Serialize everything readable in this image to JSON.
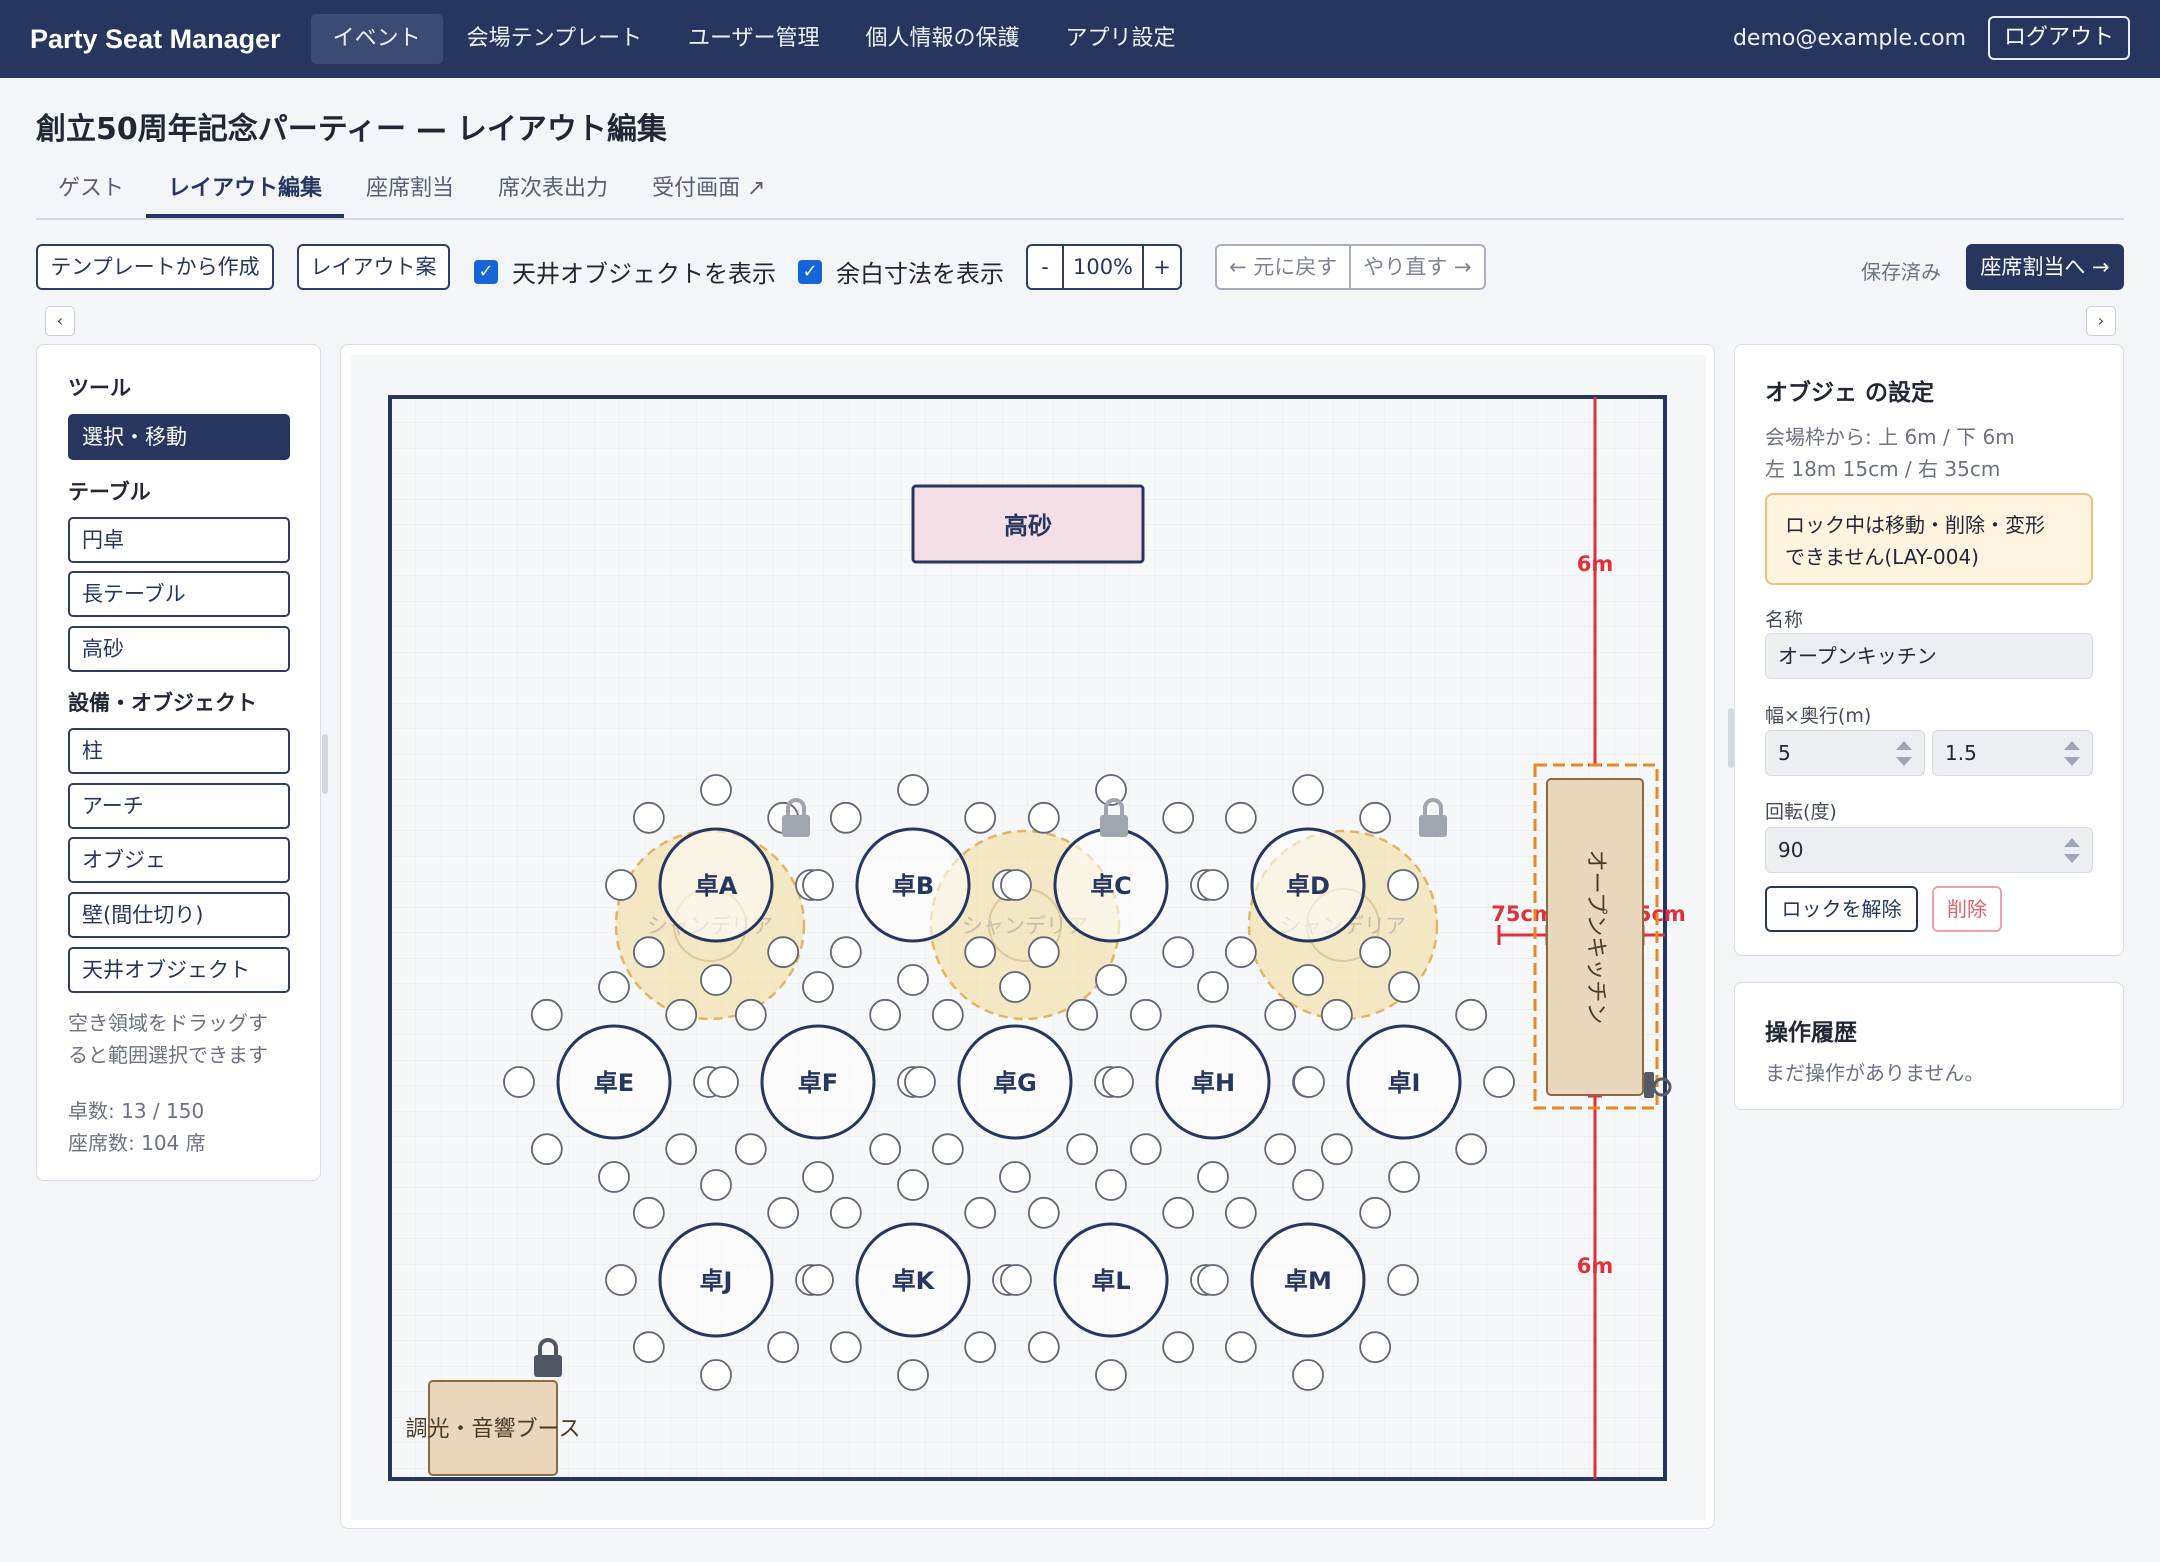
{
  "app": {
    "brand": "Party Seat Manager",
    "nav": [
      "イベント",
      "会場テンプレート",
      "ユーザー管理",
      "個人情報の保護",
      "アプリ設定"
    ],
    "user_email": "demo@example.com",
    "logout_label": "ログアウト"
  },
  "page": {
    "title": "創立50周年記念パーティー — レイアウト編集",
    "tabs": [
      "ゲスト",
      "レイアウト編集",
      "座席割当",
      "席次表出力",
      "受付画面 ↗"
    ],
    "active_tab": "レイアウト編集"
  },
  "toolbar": {
    "template_button": "テンプレートから作成",
    "layout_button": "レイアウト案",
    "show_ceiling_label": "天井オブジェクトを表示",
    "show_margin_label": "余白寸法を表示",
    "zoom_minus": "-",
    "zoom_value": "100%",
    "zoom_plus": "+",
    "undo_label": "← 元に戻す",
    "redo_label": "やり直す →",
    "save_status": "保存済み",
    "next_button": "座席割当へ →",
    "collapse_left": "‹",
    "collapse_right": "›"
  },
  "left_panel": {
    "tools_heading": "ツール",
    "select_tool": "選択・移動",
    "tables_heading": "テーブル",
    "table_tools": [
      "円卓",
      "長テーブル",
      "高砂"
    ],
    "objects_heading": "設備・オブジェクト",
    "object_tools": [
      "柱",
      "アーチ",
      "オブジェ",
      "壁(間仕切り)",
      "天井オブジェクト"
    ],
    "hint_line1": "空き領域をドラッグす",
    "hint_line2": "ると範囲選択できます",
    "table_count": "卓数: 13 / 150",
    "seat_count": "座席数: 104 席"
  },
  "canvas": {
    "head_table": "高砂",
    "tables": [
      "卓A",
      "卓B",
      "卓C",
      "卓D",
      "卓E",
      "卓F",
      "卓G",
      "卓H",
      "卓I",
      "卓J",
      "卓K",
      "卓L",
      "卓M"
    ],
    "chandelier_label": "シャンデリア",
    "kitchen_label": "オープンキッチン",
    "booth_label": "調光・音響ブース",
    "dim_top": "6m",
    "dim_bottom": "6m",
    "dim_left": "75cm",
    "dim_right": "35cm"
  },
  "right_panel": {
    "title": "オブジェ の設定",
    "distance_line1": "会場枠から: 上 6m / 下 6m",
    "distance_line2": "左 18m 15cm / 右 35cm",
    "lock_warning_line1": "ロック中は移動・削除・変形",
    "lock_warning_line2": "できません(LAY-004)",
    "name_label": "名称",
    "name_value": "オープンキッチン",
    "size_label": "幅×奥行(m)",
    "width_value": "5",
    "depth_value": "1.5",
    "rotation_label": "回転(度)",
    "rotation_value": "90",
    "unlock_button": "ロックを解除",
    "delete_button": "削除",
    "history_title": "操作履歴",
    "history_empty": "まだ操作がありません。"
  },
  "colors": {
    "navy": "#26365f",
    "accent_blue": "#1565d8",
    "warning_bg": "#fff4df",
    "dimension_red": "#e0313b",
    "selection_orange": "#e8891f"
  }
}
